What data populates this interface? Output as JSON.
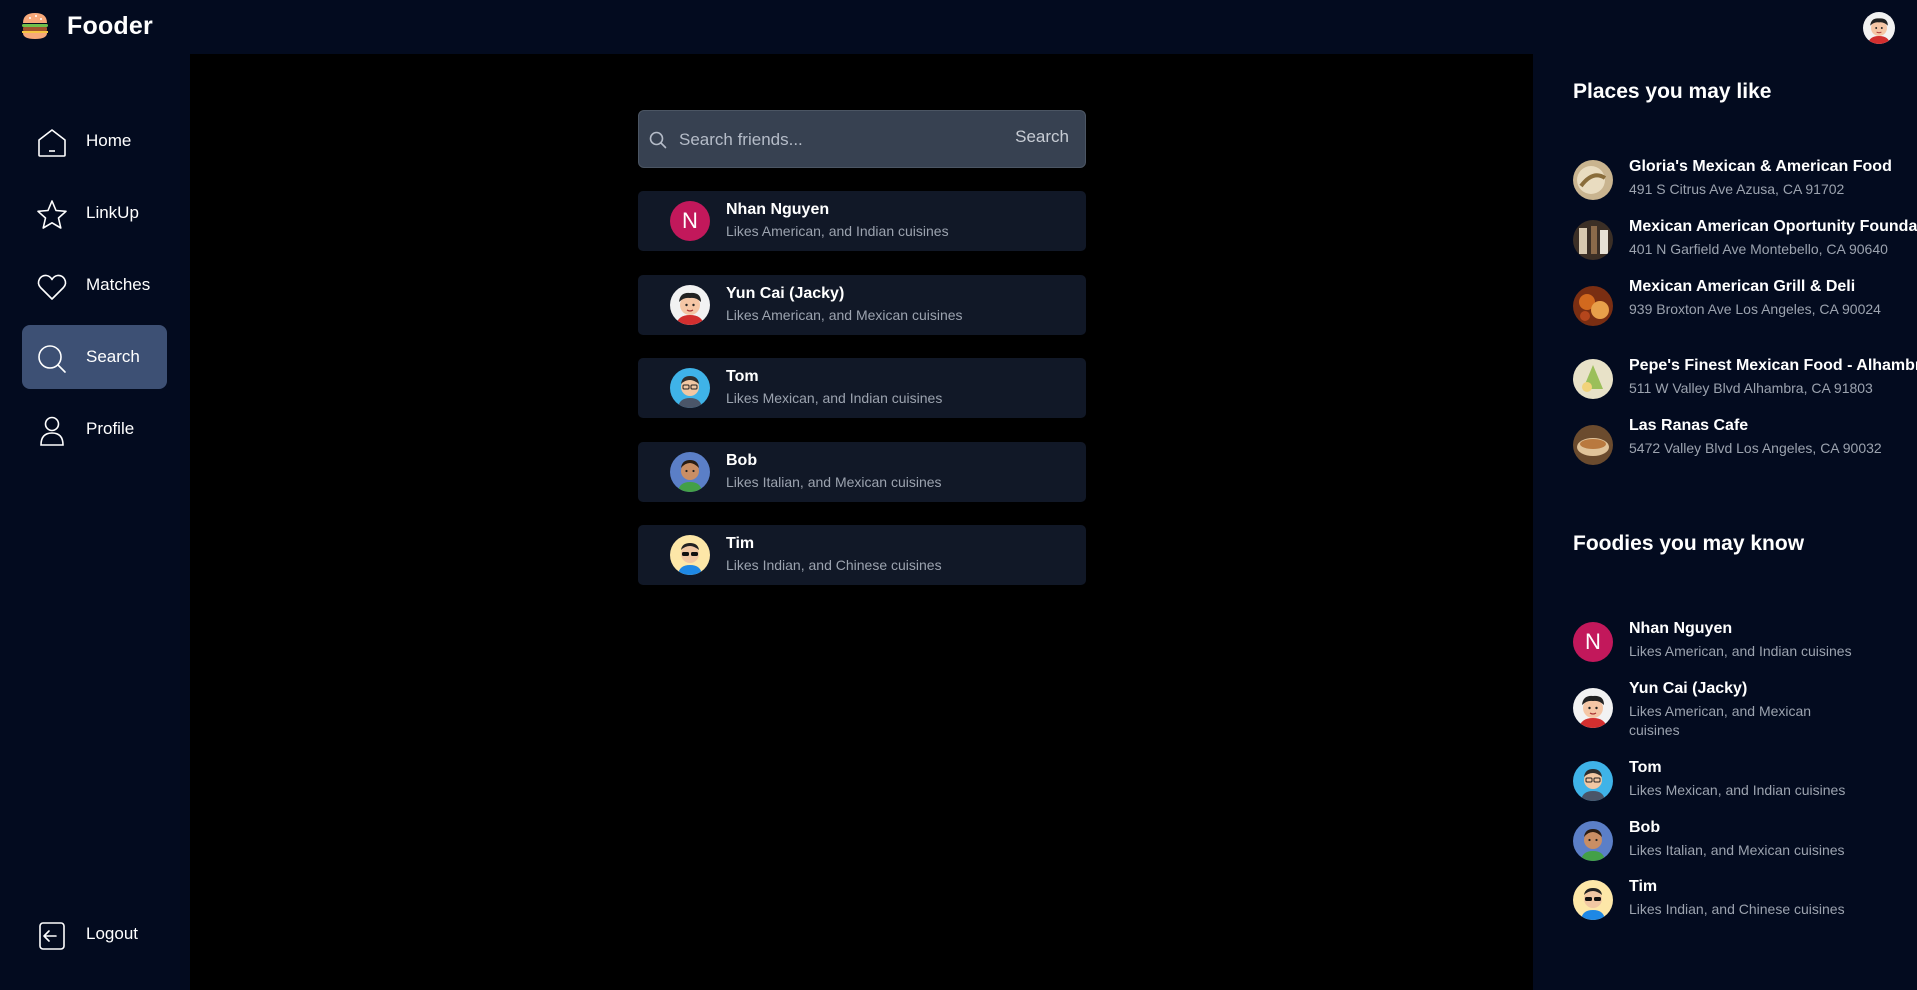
{
  "app": {
    "name": "Fooder",
    "logo_icon": "burger-icon",
    "user_avatar": "cartoon-avatar-red"
  },
  "nav": {
    "items": [
      {
        "label": "Home",
        "icon": "home-icon"
      },
      {
        "label": "LinkUp",
        "icon": "star-icon"
      },
      {
        "label": "Matches",
        "icon": "heart-icon"
      },
      {
        "label": "Search",
        "icon": "search-icon",
        "active": true
      },
      {
        "label": "Profile",
        "icon": "user-icon"
      }
    ],
    "logout": {
      "label": "Logout",
      "icon": "logout-icon"
    }
  },
  "search": {
    "placeholder": "Search friends...",
    "button_label": "Search"
  },
  "results": [
    {
      "name": "Nhan Nguyen",
      "desc": "Likes American, and Indian cuisines",
      "avatar": "initial-N"
    },
    {
      "name": "Yun Cai (Jacky)",
      "desc": "Likes American, and Mexican cuisines",
      "avatar": "cartoon-red"
    },
    {
      "name": "Tom",
      "desc": "Likes Mexican, and Indian cuisines",
      "avatar": "cartoon-blue"
    },
    {
      "name": "Bob",
      "desc": "Likes Italian, and Mexican cuisines",
      "avatar": "cartoon-green"
    },
    {
      "name": "Tim",
      "desc": "Likes Indian, and Chinese cuisines",
      "avatar": "cartoon-yellow"
    }
  ],
  "right_panel": {
    "places_heading": "Places you may like",
    "places": [
      {
        "name": "Gloria's Mexican & American Food",
        "address": "491 S Citrus Ave Azusa, CA 91702"
      },
      {
        "name": "Mexican American Oportunity Foundation",
        "address": "401 N Garfield Ave Montebello, CA 90640"
      },
      {
        "name": "Mexican American Grill & Deli",
        "address": "939 Broxton Ave Los Angeles, CA 90024"
      },
      {
        "name": "Pepe's Finest Mexican Food - Alhambra",
        "address": "511 W Valley Blvd Alhambra, CA 91803"
      },
      {
        "name": "Las Ranas Cafe",
        "address": "5472 Valley Blvd Los Angeles, CA 90032"
      }
    ],
    "foodies_heading": "Foodies you may know",
    "foodies": [
      {
        "name": "Nhan Nguyen",
        "desc": "Likes American, and Indian cuisines"
      },
      {
        "name": "Yun Cai (Jacky)",
        "desc": "Likes American, and Mexican cuisines"
      },
      {
        "name": "Tom",
        "desc": "Likes Mexican, and Indian cuisines"
      },
      {
        "name": "Bob",
        "desc": "Likes Italian, and Mexican cuisines"
      },
      {
        "name": "Tim",
        "desc": "Likes Indian, and Chinese cuisines"
      }
    ]
  },
  "colors": {
    "active_nav": "#3d5074",
    "initial_avatar": "#c2185b"
  }
}
